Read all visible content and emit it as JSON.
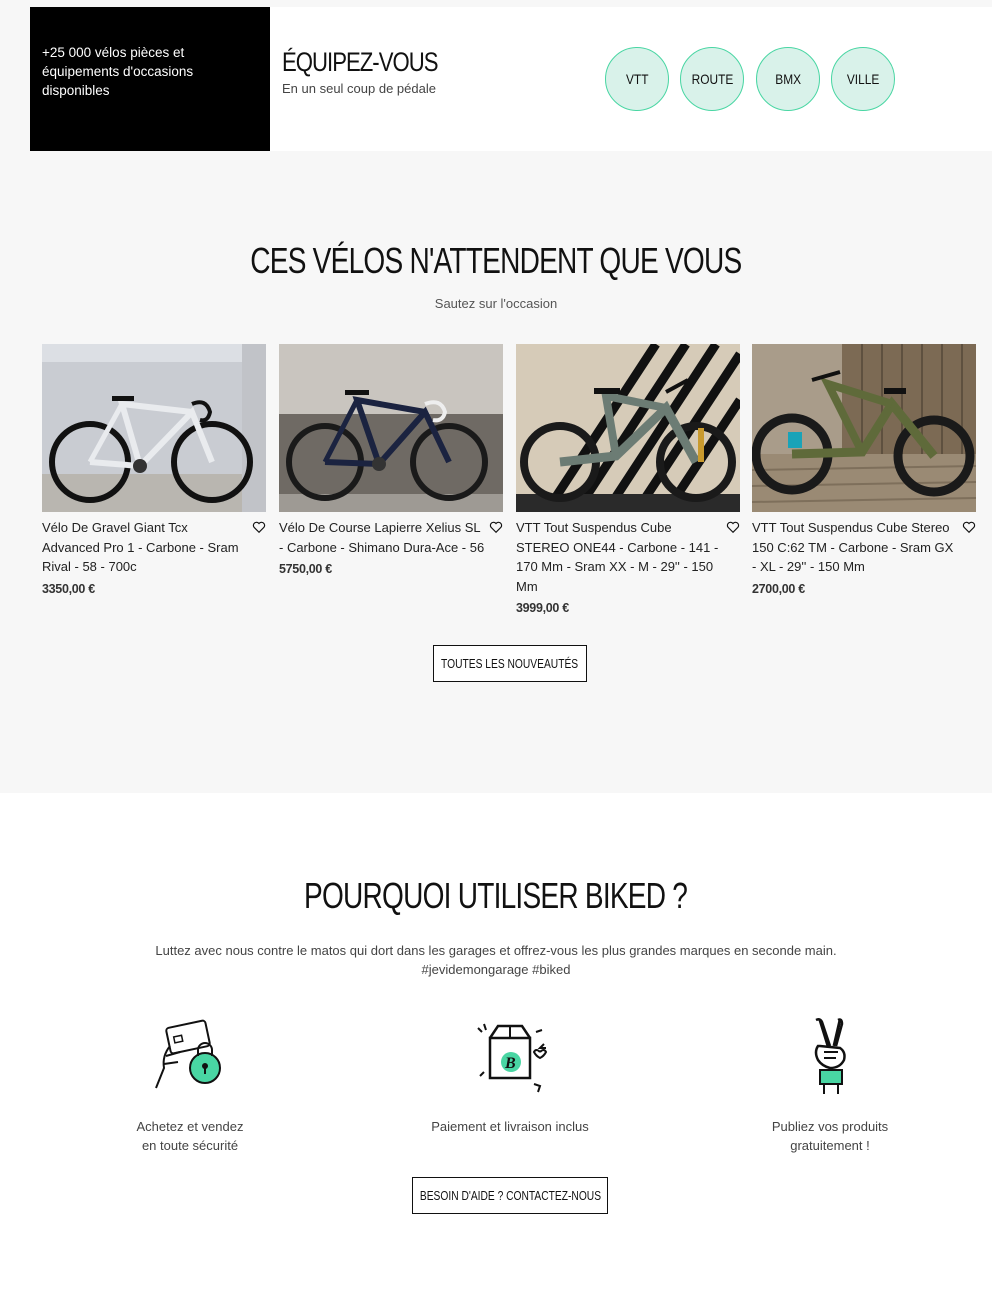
{
  "banner": {
    "stock_text": "+25 000 vélos pièces et équipements d'occasions disponibles",
    "title": "ÉQUIPEZ-VOUS",
    "subtitle": "En un seul coup de pédale",
    "categories": [
      "VTT",
      "ROUTE",
      "BMX",
      "VILLE"
    ]
  },
  "new_arrivals": {
    "title": "CES VÉLOS N'ATTENDENT QUE VOUS",
    "subtitle": "Sautez sur l'occasion",
    "products": [
      {
        "title": "Vélo De Gravel Giant Tcx Advanced Pro 1 - Carbone - Sram Rival - 58 - 700c",
        "price": "3350,00 €"
      },
      {
        "title": "Vélo De Course Lapierre Xelius SL - Carbone - Shimano Dura-Ace - 56",
        "price": "5750,00 €"
      },
      {
        "title": "VTT Tout Suspendus  Cube STEREO ONE44 - Carbone - 141 - 170 Mm - Sram XX - M - 29'' - 150 Mm",
        "price": "3999,00 €"
      },
      {
        "title": "VTT Tout Suspendus  Cube Stereo 150 C:62 TM - Carbone - Sram GX - XL - 29'' - 150 Mm",
        "price": "2700,00 €"
      }
    ],
    "all_button": "TOUTES LES NOUVEAUTÉS"
  },
  "why": {
    "title": "POURQUOI UTILISER BIKED ?",
    "text_line1": "Luttez avec nous contre le matos qui dort dans les garages et offrez-vous les plus grandes marques en seconde main.",
    "text_line2": "#jevidemongarage #biked",
    "features": [
      {
        "icon": "secure-payment-icon",
        "line1": "Achetez et vendez",
        "line2": "en toute sécurité"
      },
      {
        "icon": "delivery-box-icon",
        "line1": "Paiement et livraison inclus",
        "line2": ""
      },
      {
        "icon": "victory-hand-icon",
        "line1": "Publiez vos produits",
        "line2": "gratuitement !"
      }
    ],
    "help_button": "BESOIN D'AIDE ? CONTACTEZ-NOUS"
  },
  "colors": {
    "accent": "#49d6a3",
    "accent_light": "#d9f2ea",
    "black": "#000000",
    "grey_bg": "#f7f7f7"
  }
}
